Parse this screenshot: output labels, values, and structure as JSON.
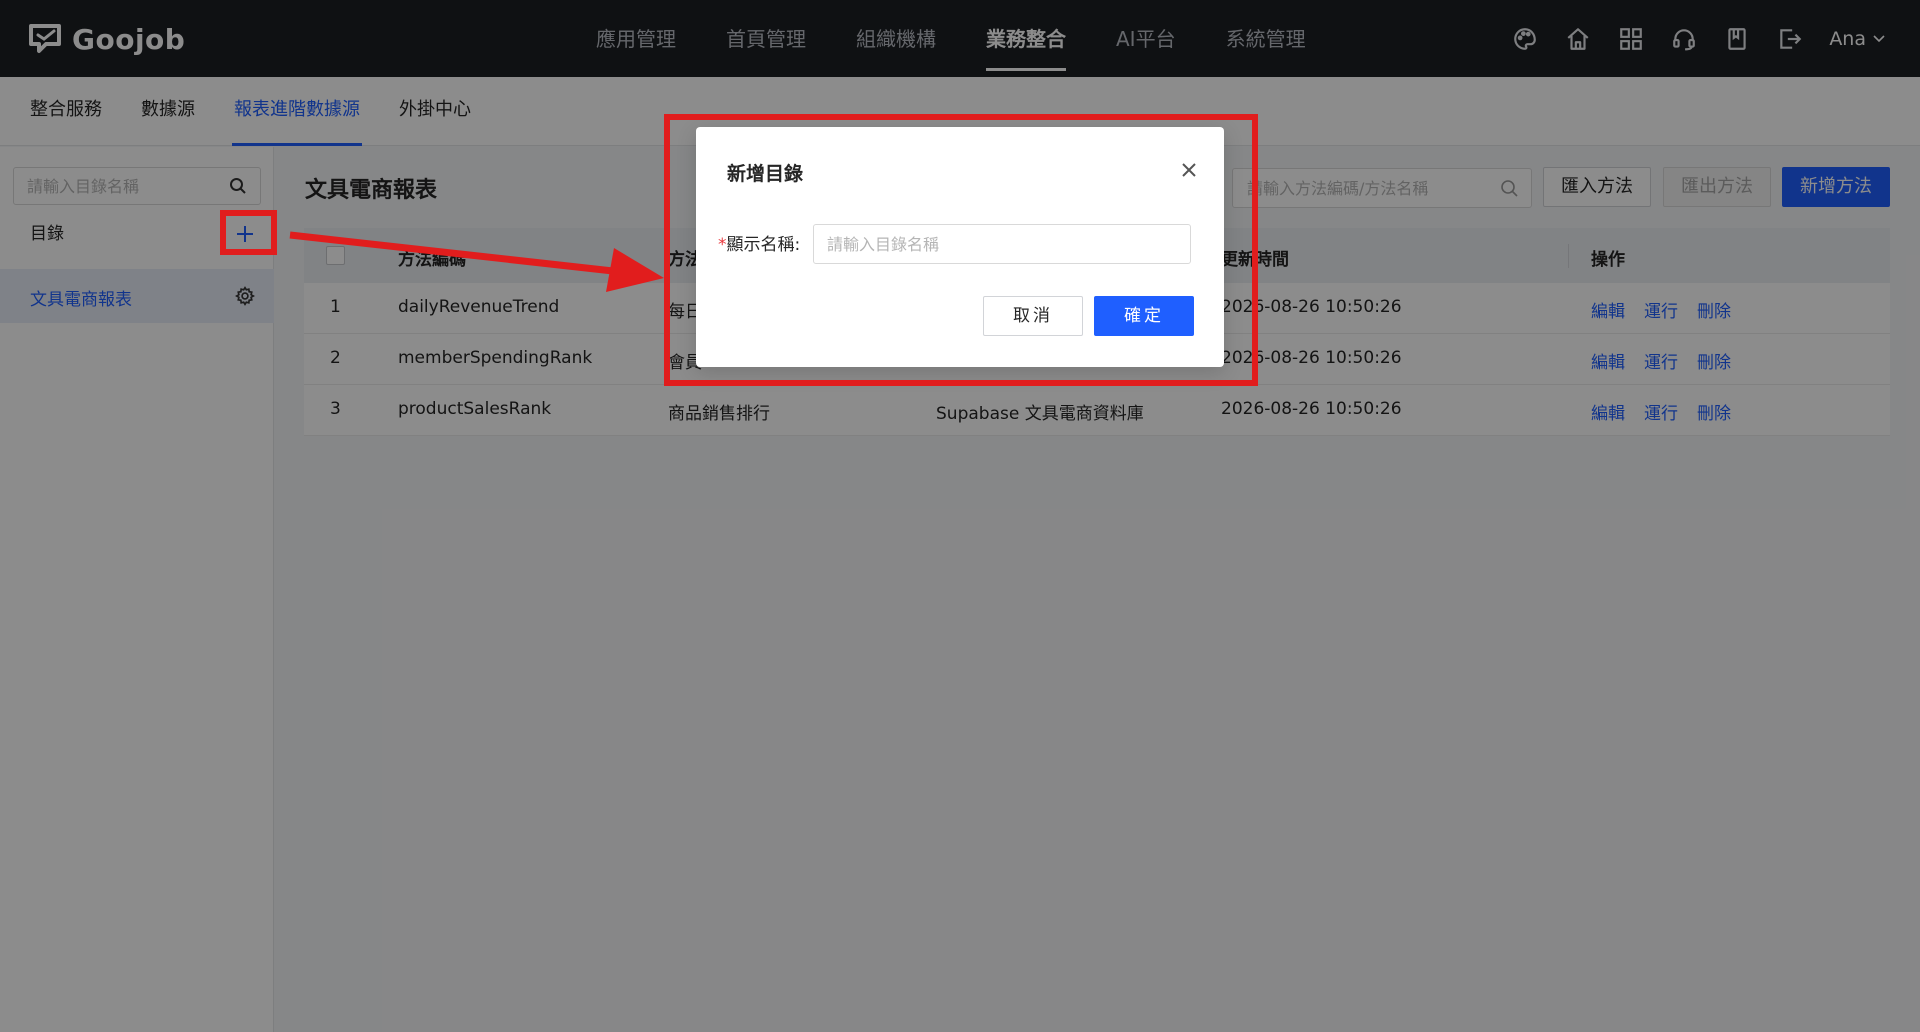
{
  "app": {
    "logo_text": "Goojob"
  },
  "topnav": {
    "items": [
      {
        "label": "應用管理"
      },
      {
        "label": "首頁管理"
      },
      {
        "label": "組織機構"
      },
      {
        "label": "業務整合"
      },
      {
        "label": "AI平台"
      },
      {
        "label": "系統管理"
      }
    ],
    "active_index": 3,
    "icons": [
      "palette-icon",
      "home-icon",
      "apps-grid-icon",
      "support-headset-icon",
      "bookmark-icon",
      "logout-icon"
    ],
    "user": "Ana"
  },
  "subnav": {
    "items": [
      {
        "label": "整合服務"
      },
      {
        "label": "數據源"
      },
      {
        "label": "報表進階數據源"
      },
      {
        "label": "外掛中心"
      }
    ],
    "active_index": 2
  },
  "sidebar": {
    "search_placeholder": "請輸入目錄名稱",
    "heading": "目錄",
    "items": [
      {
        "label": "文具電商報表"
      }
    ]
  },
  "main": {
    "title": "文具電商報表",
    "search_placeholder": "請輸入方法編碼/方法名稱",
    "buttons": {
      "import": "匯入方法",
      "export": "匯出方法",
      "add": "新增方法"
    }
  },
  "table": {
    "columns": [
      "方法編碼",
      "方法",
      "更新時間",
      "操作"
    ],
    "rows": [
      {
        "index": "1",
        "code": "dailyRevenueTrend",
        "name": "每日",
        "source": "",
        "updated": "2026-08-26 10:50:26"
      },
      {
        "index": "2",
        "code": "memberSpendingRank",
        "name": "會員",
        "source": "",
        "updated": "2026-08-26 10:50:26"
      },
      {
        "index": "3",
        "code": "productSalesRank",
        "name": "商品銷售排行",
        "source": "Supabase 文具電商資料庫",
        "updated": "2026-08-26 10:50:26"
      }
    ],
    "actions": {
      "edit": "編輯",
      "run": "運行",
      "delete": "刪除"
    }
  },
  "modal": {
    "title": "新增目錄",
    "required_mark": "*",
    "field_label": "顯示名稱:",
    "field_value": "",
    "field_placeholder": "請輸入目錄名稱",
    "cancel": "取消",
    "ok": "確定"
  },
  "colors": {
    "primary": "#1f5fff",
    "topbar": "#1c1f24",
    "annotation": "#e11d1d",
    "required": "#e8383d"
  }
}
